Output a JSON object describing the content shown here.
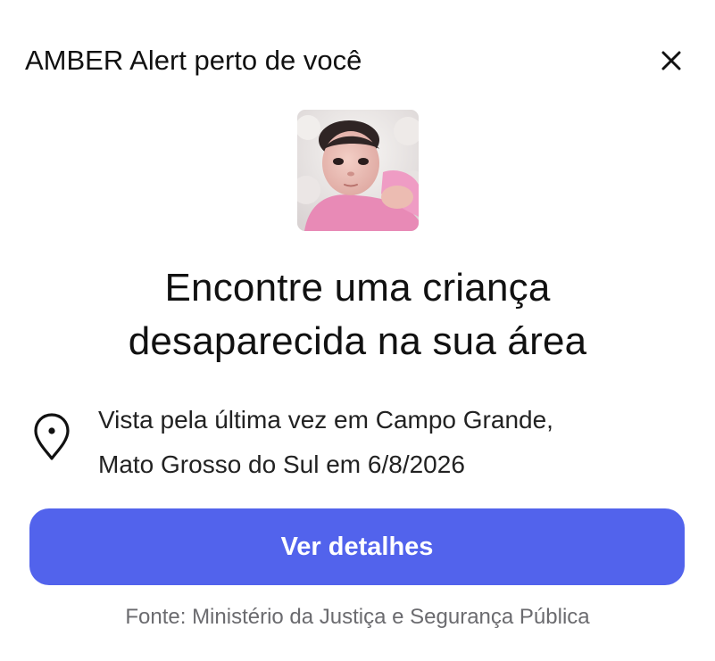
{
  "header": {
    "title": "AMBER Alert perto de você",
    "close_icon": "close-icon"
  },
  "photo": {
    "description_icon": "child-photo"
  },
  "headline": {
    "line1": "Encontre uma criança",
    "line2": "desaparecida na sua área"
  },
  "location": {
    "icon": "location-pin-icon",
    "line1": "Vista pela última vez em Campo Grande,",
    "line2": "Mato Grosso do Sul em 6/8/2026"
  },
  "actions": {
    "details_label": "Ver detalhes"
  },
  "footer": {
    "source": "Fonte: Ministério da Justiça e Segurança Pública"
  },
  "colors": {
    "accent": "#5263ec",
    "text": "#111111",
    "muted": "#6b6b6f"
  }
}
